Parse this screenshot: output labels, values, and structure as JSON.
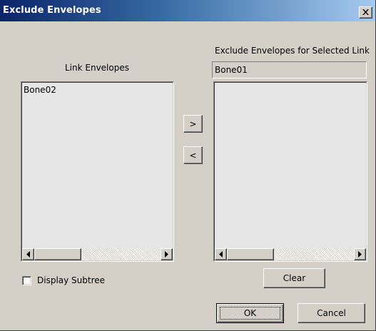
{
  "window": {
    "title": "Exclude Envelopes",
    "close_icon": "close-x-icon"
  },
  "left_panel": {
    "heading": "Link Envelopes",
    "items": [
      "Bone02"
    ]
  },
  "right_panel": {
    "heading": "Exclude Envelopes for Selected Link",
    "selected_link": "Bone01",
    "items": []
  },
  "transfer": {
    "add_label": ">",
    "remove_label": "<"
  },
  "options": {
    "display_subtree_label": "Display Subtree",
    "display_subtree_checked": false
  },
  "buttons": {
    "clear": "Clear",
    "ok": "OK",
    "cancel": "Cancel"
  },
  "colors": {
    "face": "#d4d0c8",
    "list_bg": "#e6e6e6",
    "title_start": "#0a246a",
    "title_end": "#a6caf0"
  }
}
